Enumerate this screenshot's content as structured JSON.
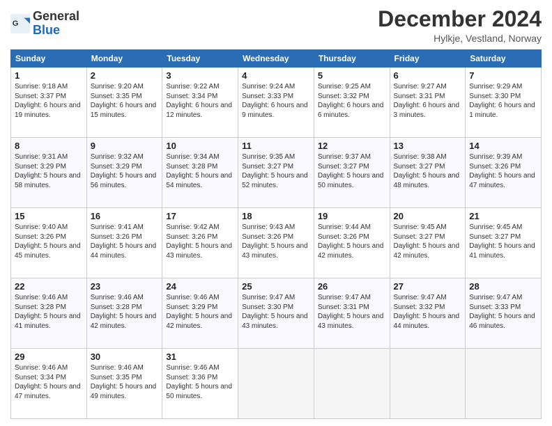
{
  "header": {
    "logo_general": "General",
    "logo_blue": "Blue",
    "month_title": "December 2024",
    "location": "Hylkje, Vestland, Norway"
  },
  "calendar": {
    "days_of_week": [
      "Sunday",
      "Monday",
      "Tuesday",
      "Wednesday",
      "Thursday",
      "Friday",
      "Saturday"
    ],
    "weeks": [
      [
        {
          "day": "1",
          "sunrise": "9:18 AM",
          "sunset": "3:37 PM",
          "daylight": "6 hours and 19 minutes."
        },
        {
          "day": "2",
          "sunrise": "9:20 AM",
          "sunset": "3:35 PM",
          "daylight": "6 hours and 15 minutes."
        },
        {
          "day": "3",
          "sunrise": "9:22 AM",
          "sunset": "3:34 PM",
          "daylight": "6 hours and 12 minutes."
        },
        {
          "day": "4",
          "sunrise": "9:24 AM",
          "sunset": "3:33 PM",
          "daylight": "6 hours and 9 minutes."
        },
        {
          "day": "5",
          "sunrise": "9:25 AM",
          "sunset": "3:32 PM",
          "daylight": "6 hours and 6 minutes."
        },
        {
          "day": "6",
          "sunrise": "9:27 AM",
          "sunset": "3:31 PM",
          "daylight": "6 hours and 3 minutes."
        },
        {
          "day": "7",
          "sunrise": "9:29 AM",
          "sunset": "3:30 PM",
          "daylight": "6 hours and 1 minute."
        }
      ],
      [
        {
          "day": "8",
          "sunrise": "9:31 AM",
          "sunset": "3:29 PM",
          "daylight": "5 hours and 58 minutes."
        },
        {
          "day": "9",
          "sunrise": "9:32 AM",
          "sunset": "3:29 PM",
          "daylight": "5 hours and 56 minutes."
        },
        {
          "day": "10",
          "sunrise": "9:34 AM",
          "sunset": "3:28 PM",
          "daylight": "5 hours and 54 minutes."
        },
        {
          "day": "11",
          "sunrise": "9:35 AM",
          "sunset": "3:27 PM",
          "daylight": "5 hours and 52 minutes."
        },
        {
          "day": "12",
          "sunrise": "9:37 AM",
          "sunset": "3:27 PM",
          "daylight": "5 hours and 50 minutes."
        },
        {
          "day": "13",
          "sunrise": "9:38 AM",
          "sunset": "3:27 PM",
          "daylight": "5 hours and 48 minutes."
        },
        {
          "day": "14",
          "sunrise": "9:39 AM",
          "sunset": "3:26 PM",
          "daylight": "5 hours and 47 minutes."
        }
      ],
      [
        {
          "day": "15",
          "sunrise": "9:40 AM",
          "sunset": "3:26 PM",
          "daylight": "5 hours and 45 minutes."
        },
        {
          "day": "16",
          "sunrise": "9:41 AM",
          "sunset": "3:26 PM",
          "daylight": "5 hours and 44 minutes."
        },
        {
          "day": "17",
          "sunrise": "9:42 AM",
          "sunset": "3:26 PM",
          "daylight": "5 hours and 43 minutes."
        },
        {
          "day": "18",
          "sunrise": "9:43 AM",
          "sunset": "3:26 PM",
          "daylight": "5 hours and 43 minutes."
        },
        {
          "day": "19",
          "sunrise": "9:44 AM",
          "sunset": "3:26 PM",
          "daylight": "5 hours and 42 minutes."
        },
        {
          "day": "20",
          "sunrise": "9:45 AM",
          "sunset": "3:27 PM",
          "daylight": "5 hours and 42 minutes."
        },
        {
          "day": "21",
          "sunrise": "9:45 AM",
          "sunset": "3:27 PM",
          "daylight": "5 hours and 41 minutes."
        }
      ],
      [
        {
          "day": "22",
          "sunrise": "9:46 AM",
          "sunset": "3:28 PM",
          "daylight": "5 hours and 41 minutes."
        },
        {
          "day": "23",
          "sunrise": "9:46 AM",
          "sunset": "3:28 PM",
          "daylight": "5 hours and 42 minutes."
        },
        {
          "day": "24",
          "sunrise": "9:46 AM",
          "sunset": "3:29 PM",
          "daylight": "5 hours and 42 minutes."
        },
        {
          "day": "25",
          "sunrise": "9:47 AM",
          "sunset": "3:30 PM",
          "daylight": "5 hours and 43 minutes."
        },
        {
          "day": "26",
          "sunrise": "9:47 AM",
          "sunset": "3:31 PM",
          "daylight": "5 hours and 43 minutes."
        },
        {
          "day": "27",
          "sunrise": "9:47 AM",
          "sunset": "3:32 PM",
          "daylight": "5 hours and 44 minutes."
        },
        {
          "day": "28",
          "sunrise": "9:47 AM",
          "sunset": "3:33 PM",
          "daylight": "5 hours and 46 minutes."
        }
      ],
      [
        {
          "day": "29",
          "sunrise": "9:46 AM",
          "sunset": "3:34 PM",
          "daylight": "5 hours and 47 minutes."
        },
        {
          "day": "30",
          "sunrise": "9:46 AM",
          "sunset": "3:35 PM",
          "daylight": "5 hours and 49 minutes."
        },
        {
          "day": "31",
          "sunrise": "9:46 AM",
          "sunset": "3:36 PM",
          "daylight": "5 hours and 50 minutes."
        },
        null,
        null,
        null,
        null
      ]
    ]
  }
}
